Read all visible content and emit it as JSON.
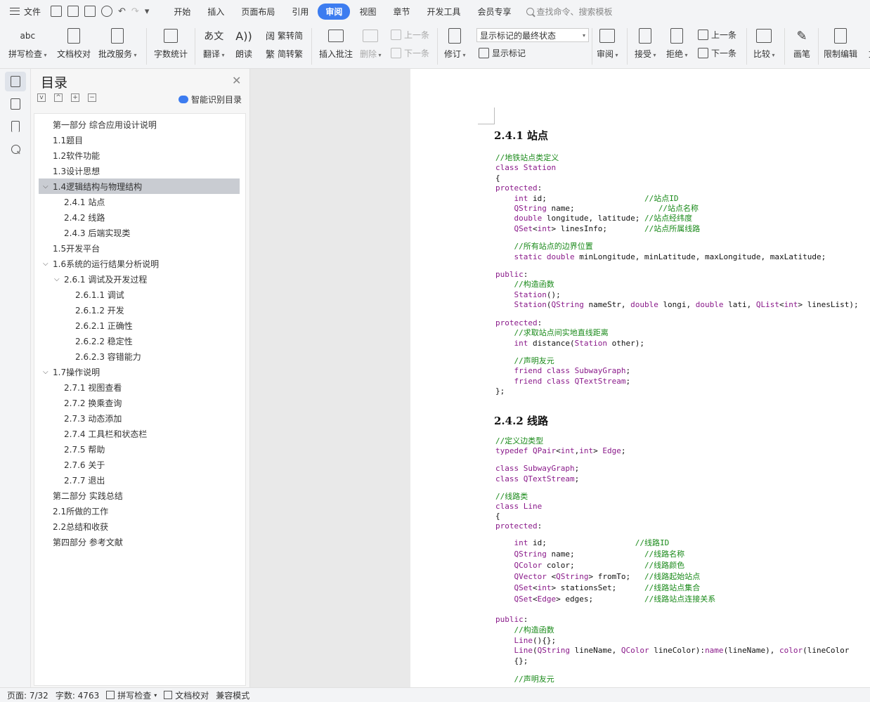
{
  "menubar": {
    "file_label": "文件",
    "tabs": [
      "开始",
      "插入",
      "页面布局",
      "引用",
      "审阅",
      "视图",
      "章节",
      "开发工具",
      "会员专享"
    ],
    "active_tab": "审阅",
    "command_search": "查找命令、搜索模板"
  },
  "ribbon": {
    "spell_check": "拼写检查",
    "doc_proof": "文档校对",
    "batch_service": "批改服务",
    "word_count": "字数统计",
    "translate": "翻译",
    "read_aloud": "朗读",
    "trad_to_simp": "繁转简",
    "simp_to_trad": "简转繁",
    "insert_comment": "插入批注",
    "delete": "删除",
    "prev_comment": "上一条",
    "next_comment": "下一条",
    "revise": "修订",
    "markup_select": "显示标记的最终状态",
    "show_markup": "显示标记",
    "review": "审阅",
    "accept": "接受",
    "reject": "拒绝",
    "prev_change": "上一条",
    "next_change": "下一条",
    "compare": "比较",
    "pen": "画笔",
    "restrict_edit": "限制编辑",
    "cut_off": "文"
  },
  "toc": {
    "title": "目录",
    "smart_label": "智能识别目录",
    "items": [
      {
        "text": "第一部分  综合应用设计说明",
        "level": 0,
        "chev": ""
      },
      {
        "text": "1.1题目",
        "level": 0,
        "chev": ""
      },
      {
        "text": "1.2软件功能",
        "level": 0,
        "chev": ""
      },
      {
        "text": "1.3设计思想",
        "level": 0,
        "chev": ""
      },
      {
        "text": "1.4逻辑结构与物理结构",
        "level": 0,
        "chev": "v",
        "selected": true
      },
      {
        "text": "2.4.1  站点",
        "level": 1,
        "chev": ""
      },
      {
        "text": "2.4.2  线路",
        "level": 1,
        "chev": ""
      },
      {
        "text": "2.4.3  后端实现类",
        "level": 1,
        "chev": ""
      },
      {
        "text": "1.5开发平台",
        "level": 0,
        "chev": ""
      },
      {
        "text": "1.6系统的运行结果分析说明",
        "level": 0,
        "chev": "v"
      },
      {
        "text": "2.6.1  调试及开发过程",
        "level": 1,
        "chev": "v"
      },
      {
        "text": "2.6.1.1  调试",
        "level": 2,
        "chev": ""
      },
      {
        "text": "2.6.1.2  开发",
        "level": 2,
        "chev": ""
      },
      {
        "text": "2.6.2.1  正确性",
        "level": 2,
        "chev": ""
      },
      {
        "text": "2.6.2.2  稳定性",
        "level": 2,
        "chev": ""
      },
      {
        "text": "2.6.2.3  容错能力",
        "level": 2,
        "chev": ""
      },
      {
        "text": "1.7操作说明",
        "level": 0,
        "chev": "v"
      },
      {
        "text": "2.7.1  视图查看",
        "level": 1,
        "chev": ""
      },
      {
        "text": "2.7.2  换乘查询",
        "level": 1,
        "chev": ""
      },
      {
        "text": "2.7.3  动态添加",
        "level": 1,
        "chev": ""
      },
      {
        "text": "2.7.4  工具栏和状态栏",
        "level": 1,
        "chev": ""
      },
      {
        "text": "2.7.5  帮助",
        "level": 1,
        "chev": ""
      },
      {
        "text": "2.7.6  关于",
        "level": 1,
        "chev": ""
      },
      {
        "text": "2.7.7  退出",
        "level": 1,
        "chev": ""
      },
      {
        "text": "第二部分  实践总结",
        "level": 0,
        "chev": ""
      },
      {
        "text": "2.1所做的工作",
        "level": 0,
        "chev": ""
      },
      {
        "text": "2.2总结和收获",
        "level": 0,
        "chev": ""
      },
      {
        "text": "第四部分  参考文献",
        "level": 0,
        "chev": ""
      }
    ]
  },
  "document": {
    "heading1": "2.4.1  站点",
    "heading2": "2.4.2  线路",
    "code1": [
      [
        [
          "cm",
          "//地铁站点类定义"
        ]
      ],
      [
        [
          "kw",
          "class "
        ],
        [
          "ty",
          "Station"
        ]
      ],
      [
        [
          "",
          "{"
        ]
      ],
      [
        [
          "kw",
          "protected"
        ],
        [
          "",
          ":"
        ]
      ],
      [
        [
          "",
          "    "
        ],
        [
          "kw",
          "int "
        ],
        [
          "",
          "id;                     "
        ],
        [
          "cm",
          "//站点ID"
        ]
      ],
      [
        [
          "",
          "    "
        ],
        [
          "ty",
          "QString "
        ],
        [
          "",
          "name;                  "
        ],
        [
          "cm",
          "//站点名称"
        ]
      ],
      [
        [
          "",
          "    "
        ],
        [
          "kw",
          "double "
        ],
        [
          "",
          "longitude, latitude; "
        ],
        [
          "cm",
          "//站点经纬度"
        ]
      ],
      [
        [
          "",
          "    "
        ],
        [
          "ty",
          "QSet"
        ],
        [
          "",
          "<"
        ],
        [
          "kw",
          "int"
        ],
        [
          "",
          "> linesInfo;        "
        ],
        [
          "cm",
          "//站点所属线路"
        ]
      ],
      [
        [
          "",
          ""
        ]
      ],
      [
        [
          "",
          "    "
        ],
        [
          "cm",
          "//所有站点的边界位置"
        ]
      ],
      [
        [
          "",
          "    "
        ],
        [
          "kw",
          "static double "
        ],
        [
          "",
          "minLongitude, minLatitude, maxLongitude, maxLatitude;"
        ]
      ],
      [
        [
          "",
          ""
        ]
      ],
      [
        [
          "kw",
          "public"
        ],
        [
          "",
          ":"
        ]
      ],
      [
        [
          "",
          "    "
        ],
        [
          "cm",
          "//构造函数"
        ]
      ],
      [
        [
          "",
          "    "
        ],
        [
          "ty",
          "Station"
        ],
        [
          "",
          "();"
        ]
      ],
      [
        [
          "",
          "    "
        ],
        [
          "ty",
          "Station"
        ],
        [
          "",
          "("
        ],
        [
          "ty",
          "QString "
        ],
        [
          "",
          "nameStr, "
        ],
        [
          "kw",
          "double "
        ],
        [
          "",
          "longi, "
        ],
        [
          "kw",
          "double "
        ],
        [
          "",
          "lati, "
        ],
        [
          "ty",
          "QList"
        ],
        [
          "",
          "<"
        ],
        [
          "kw",
          "int"
        ],
        [
          "",
          "> linesList);"
        ]
      ],
      [
        [
          "",
          ""
        ]
      ],
      [
        [
          "kw",
          "protected"
        ],
        [
          "",
          ":"
        ]
      ],
      [
        [
          "",
          "    "
        ],
        [
          "cm",
          "//求取站点间实地直线距离"
        ]
      ],
      [
        [
          "",
          "    "
        ],
        [
          "kw",
          "int "
        ],
        [
          "",
          "distance("
        ],
        [
          "ty",
          "Station "
        ],
        [
          "",
          "other);"
        ]
      ],
      [
        [
          "",
          ""
        ]
      ],
      [
        [
          "",
          "    "
        ],
        [
          "cm",
          "//声明友元"
        ]
      ],
      [
        [
          "",
          "    "
        ],
        [
          "kw",
          "friend class "
        ],
        [
          "ty",
          "SubwayGraph"
        ],
        [
          "",
          ";"
        ]
      ],
      [
        [
          "",
          "    "
        ],
        [
          "kw",
          "friend class "
        ],
        [
          "ty",
          "QTextStream"
        ],
        [
          "",
          ";"
        ]
      ],
      [
        [
          "",
          "};"
        ]
      ]
    ],
    "code2a": [
      [
        [
          "cm",
          "//定义边类型"
        ]
      ],
      [
        [
          "kw",
          "typedef "
        ],
        [
          "ty",
          "QPair"
        ],
        [
          "",
          "<"
        ],
        [
          "kw",
          "int"
        ],
        [
          "",
          ","
        ],
        [
          "kw",
          "int"
        ],
        [
          "",
          "> "
        ],
        [
          "ty",
          "Edge"
        ],
        [
          "",
          ";"
        ]
      ],
      [
        [
          "",
          ""
        ]
      ],
      [
        [
          "kw",
          "class "
        ],
        [
          "ty",
          "SubwayGraph"
        ],
        [
          "",
          ";"
        ]
      ],
      [
        [
          "kw",
          "class "
        ],
        [
          "ty",
          "QTextStream"
        ],
        [
          "",
          ";"
        ]
      ],
      [
        [
          "",
          ""
        ]
      ],
      [
        [
          "cm",
          "//线路类"
        ]
      ],
      [
        [
          "kw",
          "class "
        ],
        [
          "ty",
          "Line"
        ]
      ],
      [
        [
          "",
          "{"
        ]
      ],
      [
        [
          "kw",
          "protected"
        ],
        [
          "",
          ":"
        ]
      ]
    ],
    "code2b": [
      [
        [
          "",
          "    "
        ],
        [
          "kw",
          "int "
        ],
        [
          "",
          "id;                   "
        ],
        [
          "cm",
          "//线路ID"
        ]
      ],
      [
        [
          "",
          "    "
        ],
        [
          "ty",
          "QString "
        ],
        [
          "",
          "name;               "
        ],
        [
          "cm",
          "//线路名称"
        ]
      ],
      [
        [
          "",
          "    "
        ],
        [
          "ty",
          "QColor "
        ],
        [
          "",
          "color;               "
        ],
        [
          "cm",
          "//线路颜色"
        ]
      ],
      [
        [
          "",
          "    "
        ],
        [
          "ty",
          "QVector "
        ],
        [
          "",
          "<"
        ],
        [
          "ty",
          "QString"
        ],
        [
          "",
          "> fromTo;   "
        ],
        [
          "cm",
          "//线路起始站点"
        ]
      ],
      [
        [
          "",
          "    "
        ],
        [
          "ty",
          "QSet"
        ],
        [
          "",
          "<"
        ],
        [
          "kw",
          "int"
        ],
        [
          "",
          "> stationsSet;      "
        ],
        [
          "cm",
          "//线路站点集合"
        ]
      ],
      [
        [
          "",
          "    "
        ],
        [
          "ty",
          "QSet"
        ],
        [
          "",
          "<"
        ],
        [
          "ty",
          "Edge"
        ],
        [
          "",
          "> edges;           "
        ],
        [
          "cm",
          "//线路站点连接关系"
        ]
      ]
    ],
    "code2c": [
      [
        [
          "kw",
          "public"
        ],
        [
          "",
          ":"
        ]
      ],
      [
        [
          "",
          "    "
        ],
        [
          "cm",
          "//构造函数"
        ]
      ],
      [
        [
          "",
          "    "
        ],
        [
          "ty",
          "Line"
        ],
        [
          "",
          "(){};"
        ]
      ],
      [
        [
          "",
          "    "
        ],
        [
          "ty",
          "Line"
        ],
        [
          "",
          "("
        ],
        [
          "ty",
          "QString "
        ],
        [
          "",
          "lineName, "
        ],
        [
          "ty",
          "QColor "
        ],
        [
          "",
          "lineColor):"
        ],
        [
          "kw",
          "name"
        ],
        [
          "",
          "(lineName), "
        ],
        [
          "kw",
          "color"
        ],
        [
          "",
          "(lineColor"
        ]
      ],
      [
        [
          "",
          "    {};"
        ]
      ],
      [
        [
          "",
          ""
        ]
      ],
      [
        [
          "",
          "    "
        ],
        [
          "cm",
          "//声明友元"
        ]
      ]
    ]
  },
  "status": {
    "page": "页面: 7/32",
    "words": "字数: 4763",
    "spell": "拼写检查",
    "proof": "文档校对",
    "compat": "兼容模式"
  }
}
